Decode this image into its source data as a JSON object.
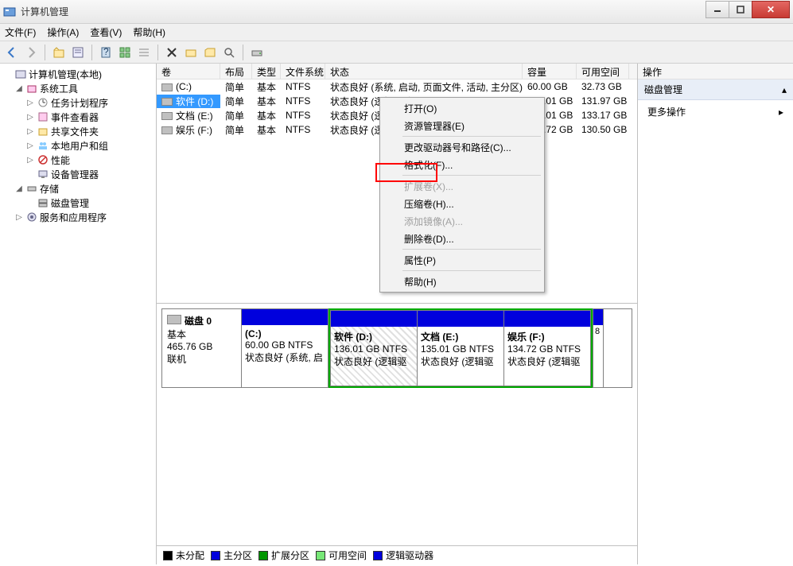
{
  "window": {
    "title": "计算机管理"
  },
  "menubar": {
    "file": "文件(F)",
    "action": "操作(A)",
    "view": "查看(V)",
    "help": "帮助(H)"
  },
  "tree": {
    "root": "计算机管理(本地)",
    "system_tools": "系统工具",
    "task_scheduler": "任务计划程序",
    "event_viewer": "事件查看器",
    "shared_folders": "共享文件夹",
    "local_users": "本地用户和组",
    "performance": "性能",
    "device_mgr": "设备管理器",
    "storage": "存储",
    "disk_mgmt": "磁盘管理",
    "services": "服务和应用程序"
  },
  "columns": {
    "volume": "卷",
    "layout": "布局",
    "type": "类型",
    "fs": "文件系统",
    "status": "状态",
    "capacity": "容量",
    "free": "可用空间"
  },
  "volumes": [
    {
      "name": "(C:)",
      "layout": "简单",
      "type": "基本",
      "fs": "NTFS",
      "status": "状态良好 (系统, 启动, 页面文件, 活动, 主分区)",
      "capacity": "60.00 GB",
      "free": "32.73 GB"
    },
    {
      "name": "软件 (D:)",
      "layout": "简单",
      "type": "基本",
      "fs": "NTFS",
      "status": "状态良好 (逻辑驱动器)",
      "capacity": "136.01 GB",
      "free": "131.97 GB"
    },
    {
      "name": "文档 (E:)",
      "layout": "简单",
      "type": "基本",
      "fs": "NTFS",
      "status": "状态良好 (逻辑驱动器)",
      "capacity": "135.01 GB",
      "free": "133.17 GB"
    },
    {
      "name": "娱乐 (F:)",
      "layout": "简单",
      "type": "基本",
      "fs": "NTFS",
      "status": "状态良好 (逻辑驱动器)",
      "capacity": "134.72 GB",
      "free": "130.50 GB"
    }
  ],
  "ctx": {
    "open": "打开(O)",
    "explorer": "资源管理器(E)",
    "change_drive": "更改驱动器号和路径(C)...",
    "format": "格式化(F)...",
    "extend": "扩展卷(X)...",
    "shrink": "压缩卷(H)...",
    "mirror": "添加镜像(A)...",
    "delete": "删除卷(D)...",
    "properties": "属性(P)",
    "help": "帮助(H)"
  },
  "disk": {
    "label": "磁盘 0",
    "type": "基本",
    "size": "465.76 GB",
    "state": "联机",
    "parts": [
      {
        "name": "(C:)",
        "size": "60.00 GB NTFS",
        "status": "状态良好 (系统, 启"
      },
      {
        "name": "软件  (D:)",
        "size": "136.01 GB NTFS",
        "status": "状态良好 (逻辑驱"
      },
      {
        "name": "文档  (E:)",
        "size": "135.01 GB NTFS",
        "status": "状态良好 (逻辑驱"
      },
      {
        "name": "娱乐  (F:)",
        "size": "134.72 GB NTFS",
        "status": "状态良好 (逻辑驱"
      }
    ],
    "end": "8"
  },
  "legend": {
    "unalloc": "未分配",
    "primary": "主分区",
    "extended": "扩展分区",
    "free": "可用空间",
    "logical": "逻辑驱动器"
  },
  "actions": {
    "header": "操作",
    "group": "磁盘管理",
    "more": "更多操作"
  }
}
